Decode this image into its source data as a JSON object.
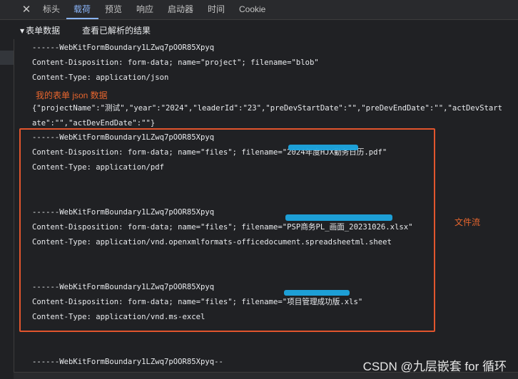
{
  "tabs": {
    "close_icon": "✕",
    "items": [
      "标头",
      "载荷",
      "预览",
      "响应",
      "启动器",
      "时间",
      "Cookie"
    ],
    "active": "载荷",
    "active_color": "#8ab4f8"
  },
  "section": {
    "title": "表单数据",
    "action": "查看已解析的结果"
  },
  "payload": {
    "part1": {
      "boundary": "------WebKitFormBoundary1LZwq7pOOR85Xpyq",
      "disposition": "Content-Disposition: form-data; name=\"project\"; filename=\"blob\"",
      "content_type": "Content-Type: application/json"
    },
    "json_line1": "{\"projectName\":\"测试\",\"year\":\"2024\",\"leaderId\":\"23\",\"preDevStartDate\":\"\",\"preDevEndDate\":\"\",\"actDevStart",
    "json_line2": "ate\":\"\",\"actDevEndDate\":\"\"}",
    "part2": {
      "boundary": "------WebKitFormBoundary1LZwq7pOOR85Xpyq",
      "disposition": "Content-Disposition: form-data; name=\"files\"; filename=\"2024年度HJX勤务日历.pdf\"",
      "content_type": "Content-Type: application/pdf"
    },
    "part3": {
      "boundary": "------WebKitFormBoundary1LZwq7pOOR85Xpyq",
      "disposition": "Content-Disposition: form-data; name=\"files\"; filename=\"PSP商务PL_画面_20231026.xlsx\"",
      "content_type": "Content-Type: application/vnd.openxmlformats-officedocument.spreadsheetml.sheet"
    },
    "part4": {
      "boundary": "------WebKitFormBoundary1LZwq7pOOR85Xpyq",
      "disposition": "Content-Disposition: form-data; name=\"files\"; filename=\"项目管理成功版.xls\"",
      "content_type": "Content-Type: application/vnd.ms-excel"
    },
    "closing_boundary": "------WebKitFormBoundary1LZwq7pOOR85Xpyq--"
  },
  "annotations": {
    "json_label": "我的表单 json 数据",
    "file_stream_label": "文件流",
    "color": "#e8662e"
  },
  "watermark": "CSDN @九层嵌套 for 循环"
}
